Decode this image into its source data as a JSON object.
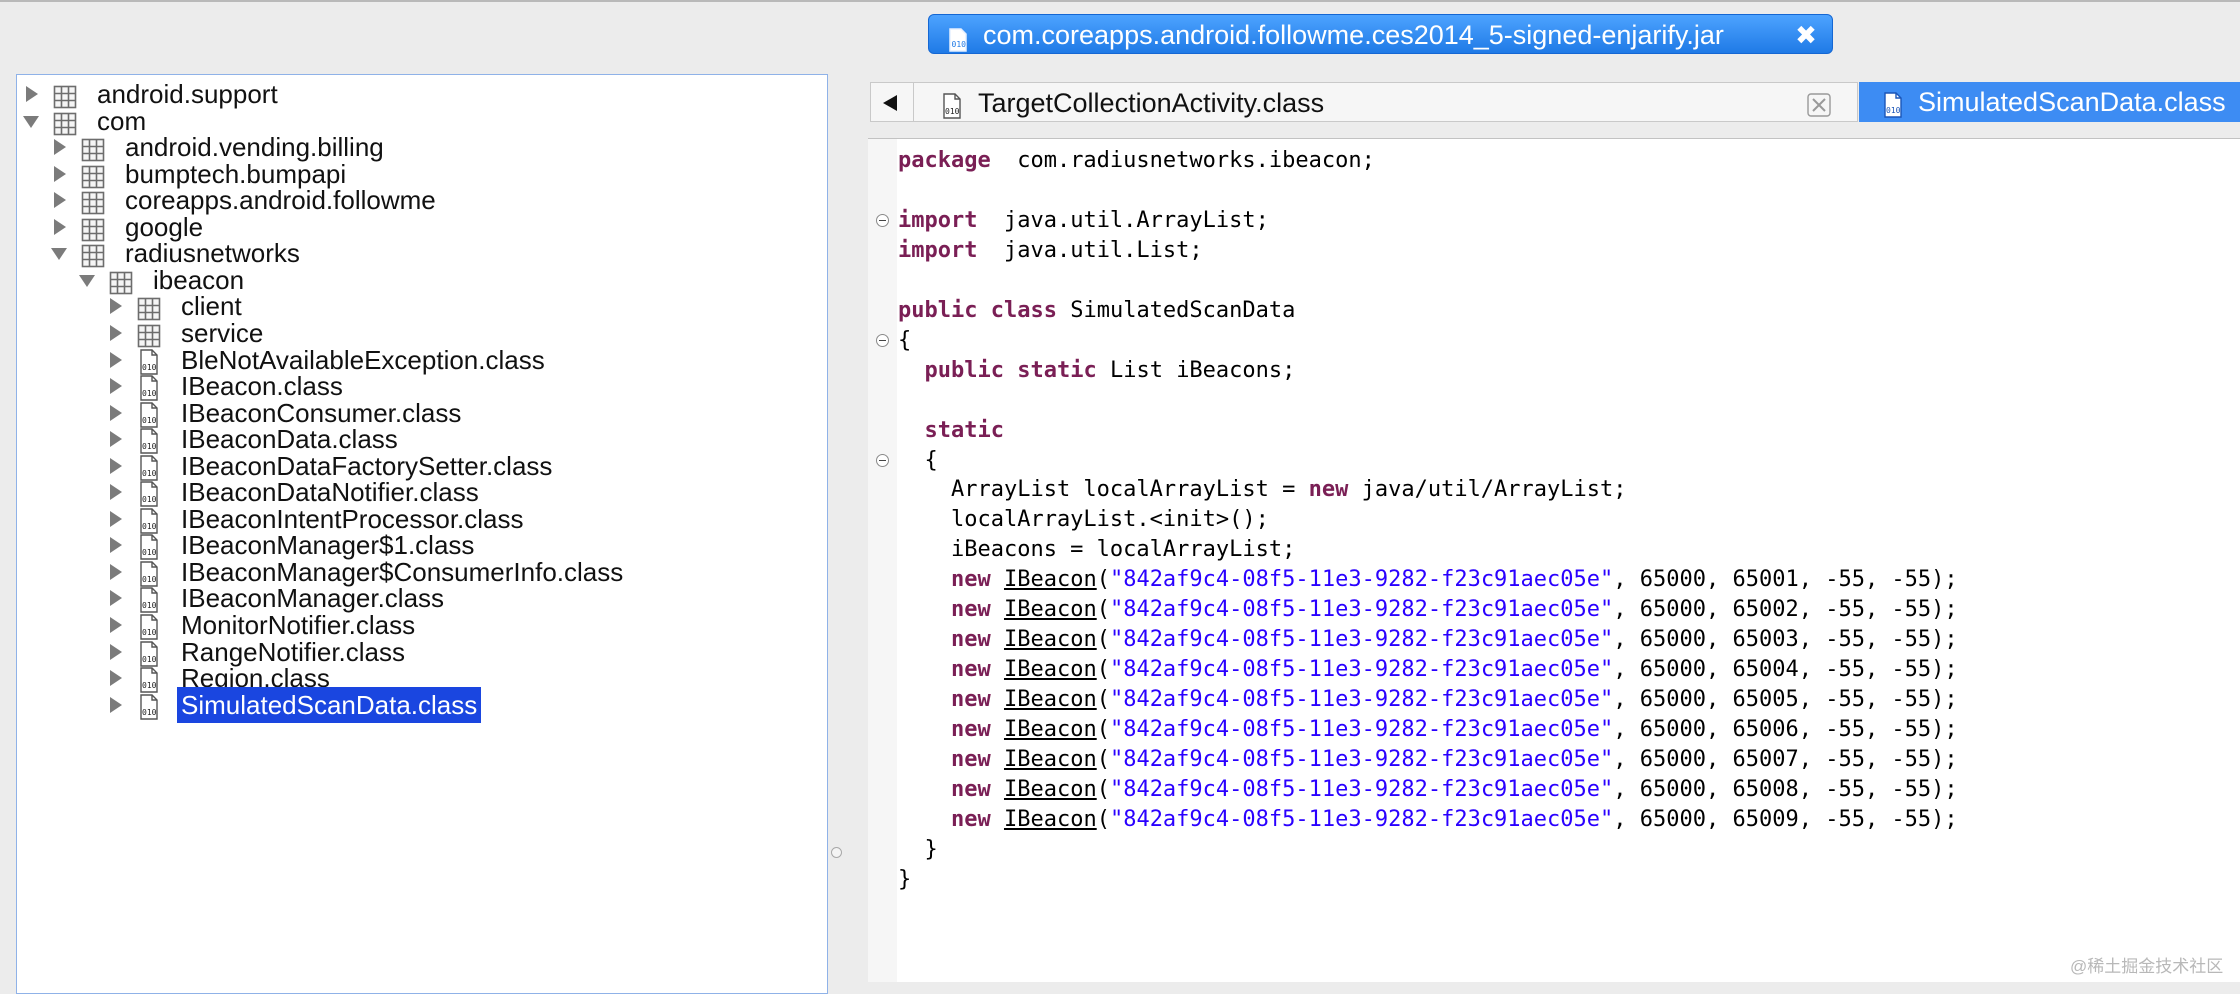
{
  "jar_tab": {
    "label": "com.coreapps.android.followme.ces2014_5-signed-enjarify.jar",
    "close_glyph": "✖"
  },
  "tree": {
    "rows": [
      {
        "label": "android.support",
        "icon": "package-icon",
        "depth": 0,
        "state": "collapsed"
      },
      {
        "label": "com",
        "icon": "package-icon",
        "depth": 0,
        "state": "expanded"
      },
      {
        "label": "android.vending.billing",
        "icon": "package-icon",
        "depth": 1,
        "state": "collapsed"
      },
      {
        "label": "bumptech.bumpapi",
        "icon": "package-icon",
        "depth": 1,
        "state": "collapsed"
      },
      {
        "label": "coreapps.android.followme",
        "icon": "package-icon",
        "depth": 1,
        "state": "collapsed"
      },
      {
        "label": "google",
        "icon": "package-icon",
        "depth": 1,
        "state": "collapsed"
      },
      {
        "label": "radiusnetworks",
        "icon": "package-icon",
        "depth": 1,
        "state": "expanded"
      },
      {
        "label": "ibeacon",
        "icon": "package-icon",
        "depth": 2,
        "state": "expanded"
      },
      {
        "label": "client",
        "icon": "package-icon",
        "depth": 3,
        "state": "collapsed"
      },
      {
        "label": "service",
        "icon": "package-icon",
        "depth": 3,
        "state": "collapsed"
      },
      {
        "label": "BleNotAvailableException.class",
        "icon": "class-file-icon",
        "depth": 3,
        "state": "collapsed"
      },
      {
        "label": "IBeacon.class",
        "icon": "class-file-icon",
        "depth": 3,
        "state": "collapsed"
      },
      {
        "label": "IBeaconConsumer.class",
        "icon": "class-file-icon",
        "depth": 3,
        "state": "collapsed"
      },
      {
        "label": "IBeaconData.class",
        "icon": "class-file-icon",
        "depth": 3,
        "state": "collapsed"
      },
      {
        "label": "IBeaconDataFactorySetter.class",
        "icon": "class-file-icon",
        "depth": 3,
        "state": "collapsed"
      },
      {
        "label": "IBeaconDataNotifier.class",
        "icon": "class-file-icon",
        "depth": 3,
        "state": "collapsed"
      },
      {
        "label": "IBeaconIntentProcessor.class",
        "icon": "class-file-icon",
        "depth": 3,
        "state": "collapsed"
      },
      {
        "label": "IBeaconManager$1.class",
        "icon": "class-file-icon",
        "depth": 3,
        "state": "collapsed"
      },
      {
        "label": "IBeaconManager$ConsumerInfo.class",
        "icon": "class-file-icon",
        "depth": 3,
        "state": "collapsed"
      },
      {
        "label": "IBeaconManager.class",
        "icon": "class-file-icon",
        "depth": 3,
        "state": "collapsed"
      },
      {
        "label": "MonitorNotifier.class",
        "icon": "class-file-icon",
        "depth": 3,
        "state": "collapsed"
      },
      {
        "label": "RangeNotifier.class",
        "icon": "class-file-icon",
        "depth": 3,
        "state": "collapsed"
      },
      {
        "label": "Region.class",
        "icon": "class-file-icon",
        "depth": 3,
        "state": "collapsed"
      },
      {
        "label": "SimulatedScanData.class",
        "icon": "class-file-icon",
        "depth": 3,
        "state": "collapsed",
        "selected": true
      }
    ]
  },
  "editor_tabs": {
    "back_icon": "back-arrow-icon",
    "tab1": {
      "label": "TargetCollectionActivity.class",
      "icon": "class-file-icon",
      "close_icon": "close-icon"
    },
    "tab2": {
      "label": "SimulatedScanData.class",
      "icon": "class-file-icon"
    }
  },
  "code": {
    "lines": [
      {
        "tokens": [
          [
            "kw",
            "package"
          ],
          [
            "",
            "  com.radiusnetworks.ibeacon;"
          ]
        ]
      },
      {
        "tokens": []
      },
      {
        "fold": true,
        "tokens": [
          [
            "kw",
            "import"
          ],
          [
            "",
            "  java.util.ArrayList;"
          ]
        ]
      },
      {
        "tokens": [
          [
            "kw",
            "import"
          ],
          [
            "",
            "  java.util.List;"
          ]
        ]
      },
      {
        "tokens": []
      },
      {
        "tokens": [
          [
            "kw",
            "public"
          ],
          [
            "",
            " "
          ],
          [
            "kw",
            "class"
          ],
          [
            "",
            " SimulatedScanData"
          ]
        ]
      },
      {
        "fold": true,
        "tokens": [
          [
            "",
            "{"
          ]
        ]
      },
      {
        "tokens": [
          [
            "",
            "  "
          ],
          [
            "kw",
            "public"
          ],
          [
            "",
            " "
          ],
          [
            "kw",
            "static"
          ],
          [
            "",
            " List iBeacons;"
          ]
        ]
      },
      {
        "tokens": []
      },
      {
        "tokens": [
          [
            "",
            "  "
          ],
          [
            "kw",
            "static"
          ]
        ]
      },
      {
        "fold": true,
        "tokens": [
          [
            "",
            "  {"
          ]
        ]
      },
      {
        "tokens": [
          [
            "",
            "    ArrayList localArrayList = "
          ],
          [
            "kw",
            "new"
          ],
          [
            "",
            " java/util/ArrayList;"
          ]
        ]
      },
      {
        "tokens": [
          [
            "",
            "    localArrayList.<init>();"
          ]
        ]
      },
      {
        "tokens": [
          [
            "",
            "    iBeacons = localArrayList;"
          ]
        ]
      },
      {
        "tokens": [
          [
            "",
            "    "
          ],
          [
            "kw",
            "new"
          ],
          [
            "",
            " "
          ],
          [
            "cls",
            "IBeacon"
          ],
          [
            "",
            "("
          ],
          [
            "str",
            "\"842af9c4-08f5-11e3-9282-f23c91aec05e\""
          ],
          [
            "",
            ", 65000, 65001, -55, -55);"
          ]
        ]
      },
      {
        "tokens": [
          [
            "",
            "    "
          ],
          [
            "kw",
            "new"
          ],
          [
            "",
            " "
          ],
          [
            "cls",
            "IBeacon"
          ],
          [
            "",
            "("
          ],
          [
            "str",
            "\"842af9c4-08f5-11e3-9282-f23c91aec05e\""
          ],
          [
            "",
            ", 65000, 65002, -55, -55);"
          ]
        ]
      },
      {
        "tokens": [
          [
            "",
            "    "
          ],
          [
            "kw",
            "new"
          ],
          [
            "",
            " "
          ],
          [
            "cls",
            "IBeacon"
          ],
          [
            "",
            "("
          ],
          [
            "str",
            "\"842af9c4-08f5-11e3-9282-f23c91aec05e\""
          ],
          [
            "",
            ", 65000, 65003, -55, -55);"
          ]
        ]
      },
      {
        "tokens": [
          [
            "",
            "    "
          ],
          [
            "kw",
            "new"
          ],
          [
            "",
            " "
          ],
          [
            "cls",
            "IBeacon"
          ],
          [
            "",
            "("
          ],
          [
            "str",
            "\"842af9c4-08f5-11e3-9282-f23c91aec05e\""
          ],
          [
            "",
            ", 65000, 65004, -55, -55);"
          ]
        ]
      },
      {
        "tokens": [
          [
            "",
            "    "
          ],
          [
            "kw",
            "new"
          ],
          [
            "",
            " "
          ],
          [
            "cls",
            "IBeacon"
          ],
          [
            "",
            "("
          ],
          [
            "str",
            "\"842af9c4-08f5-11e3-9282-f23c91aec05e\""
          ],
          [
            "",
            ", 65000, 65005, -55, -55);"
          ]
        ]
      },
      {
        "tokens": [
          [
            "",
            "    "
          ],
          [
            "kw",
            "new"
          ],
          [
            "",
            " "
          ],
          [
            "cls",
            "IBeacon"
          ],
          [
            "",
            "("
          ],
          [
            "str",
            "\"842af9c4-08f5-11e3-9282-f23c91aec05e\""
          ],
          [
            "",
            ", 65000, 65006, -55, -55);"
          ]
        ]
      },
      {
        "tokens": [
          [
            "",
            "    "
          ],
          [
            "kw",
            "new"
          ],
          [
            "",
            " "
          ],
          [
            "cls",
            "IBeacon"
          ],
          [
            "",
            "("
          ],
          [
            "str",
            "\"842af9c4-08f5-11e3-9282-f23c91aec05e\""
          ],
          [
            "",
            ", 65000, 65007, -55, -55);"
          ]
        ]
      },
      {
        "tokens": [
          [
            "",
            "    "
          ],
          [
            "kw",
            "new"
          ],
          [
            "",
            " "
          ],
          [
            "cls",
            "IBeacon"
          ],
          [
            "",
            "("
          ],
          [
            "str",
            "\"842af9c4-08f5-11e3-9282-f23c91aec05e\""
          ],
          [
            "",
            ", 65000, 65008, -55, -55);"
          ]
        ]
      },
      {
        "tokens": [
          [
            "",
            "    "
          ],
          [
            "kw",
            "new"
          ],
          [
            "",
            " "
          ],
          [
            "cls",
            "IBeacon"
          ],
          [
            "",
            "("
          ],
          [
            "str",
            "\"842af9c4-08f5-11e3-9282-f23c91aec05e\""
          ],
          [
            "",
            ", 65000, 65009, -55, -55);"
          ]
        ]
      },
      {
        "tokens": [
          [
            "",
            "  }"
          ]
        ]
      },
      {
        "tokens": [
          [
            "",
            "}"
          ]
        ]
      }
    ]
  },
  "watermark": "@稀土掘金技术社区",
  "colors": {
    "accent": "#3d8cf3",
    "selection": "#1a46e0",
    "keyword": "#7a1f55",
    "string": "#2a00ff"
  }
}
